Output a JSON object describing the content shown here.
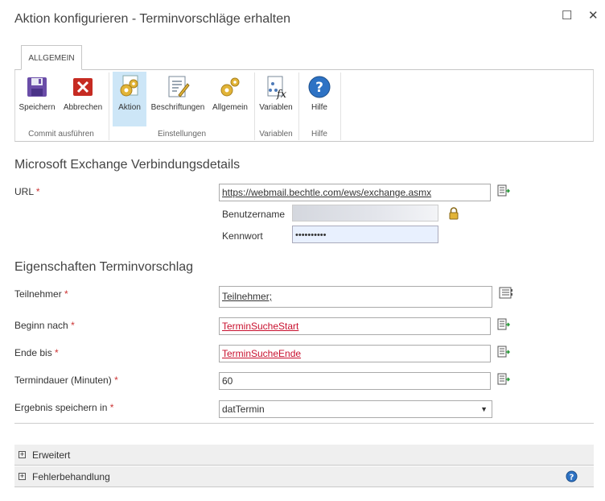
{
  "window": {
    "title": "Aktion konfigurieren - Terminvorschläge erhalten",
    "maximize_icon": "☐",
    "close_icon": "✕"
  },
  "ribbon": {
    "tab": "ALLGEMEIN",
    "buttons": {
      "save": "Speichern",
      "cancel": "Abbrechen",
      "action": "Aktion",
      "labels": "Beschriftungen",
      "general": "Allgemein",
      "variables": "Variablen",
      "help": "Hilfe"
    },
    "groups": {
      "commit": "Commit ausführen",
      "settings": "Einstellungen",
      "variables": "Variablen",
      "help": "Hilfe"
    }
  },
  "exchange": {
    "title": "Microsoft Exchange Verbindungsdetails",
    "url_label": "URL",
    "url_value": "https://webmail.bechtle.com/ews/exchange.asmx",
    "username_label": "Benutzername",
    "password_label": "Kennwort",
    "password_value": "••••••••••"
  },
  "props": {
    "title": "Eigenschaften Terminvorschlag",
    "attendees_label": "Teilnehmer",
    "attendees_value": "Teilnehmer;",
    "start_label": "Beginn nach",
    "start_value": "TerminSucheStart",
    "end_label": "Ende bis",
    "end_value": "TerminSucheEnde",
    "duration_label": "Termindauer (Minuten)",
    "duration_value": "60",
    "result_label": "Ergebnis speichern in",
    "result_value": "datTermin"
  },
  "sections": {
    "advanced": "Erweitert",
    "error_handling": "Fehlerbehandlung"
  },
  "colors": {
    "accent": "#2b6cb0",
    "selected": "#cde6f7",
    "required": "#cc3333",
    "reference_link": "#c8102e"
  }
}
